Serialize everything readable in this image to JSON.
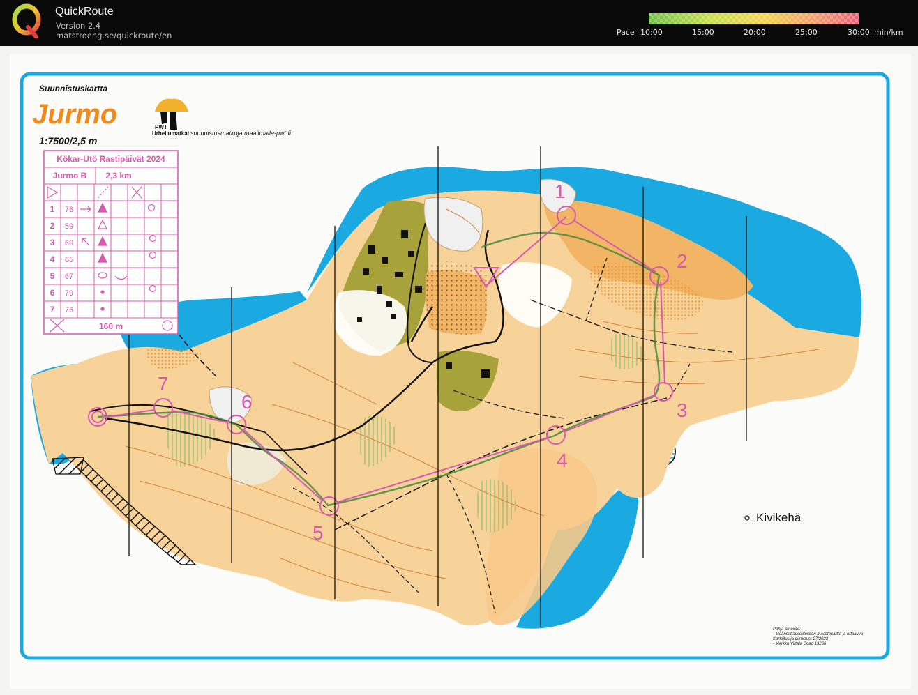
{
  "app": {
    "name": "QuickRoute",
    "version": "Version 2.4",
    "url": "matstroeng.se/quickroute/en"
  },
  "pace_legend": {
    "label": "Pace",
    "ticks": [
      "10:00",
      "15:00",
      "20:00",
      "25:00",
      "30:00"
    ],
    "unit": "min/km",
    "gradient_colors": [
      "#6fbf44",
      "#d9e64a",
      "#f4c542",
      "#ee8a6a",
      "#e8607a"
    ]
  },
  "map": {
    "header": "Suunnistuskartta",
    "title": "Jurmo",
    "scale": "1:7500/2,5 m",
    "publisher_short": "PWT",
    "publisher": "Urheilumatkat",
    "publisher_url": "suunnistusmatkoja maailmalle-pwt.fi",
    "event": "Kökar-Utö Rastipäivät 2024",
    "course": "Jurmo B",
    "distance": "2,3 km",
    "finish_distance": "160 m",
    "place_label": "Kivikehä",
    "credits": [
      "Pohja-aineisto:",
      "- Maanmittauslaitoksen maastokartta ja ortokuva",
      "Kartoitus ja piirustus: 07/2023",
      "- Markku Virtala Ocad 13266"
    ],
    "controls_table": [
      {
        "n": "1",
        "code": "78"
      },
      {
        "n": "2",
        "code": "59"
      },
      {
        "n": "3",
        "code": "60"
      },
      {
        "n": "4",
        "code": "65"
      },
      {
        "n": "5",
        "code": "67"
      },
      {
        "n": "6",
        "code": "79"
      },
      {
        "n": "7",
        "code": "76"
      }
    ],
    "control_numbers": [
      "1",
      "2",
      "3",
      "4",
      "5",
      "6",
      "7"
    ],
    "colors": {
      "water": "#1aa9e1",
      "open_land": "#f7d39a",
      "rough_open": "#f2b565",
      "forest_green": "#a7a23a",
      "course_magenta": "#d85ab0",
      "frame": "#1aa9e1",
      "title_orange": "#f08a1c"
    }
  }
}
